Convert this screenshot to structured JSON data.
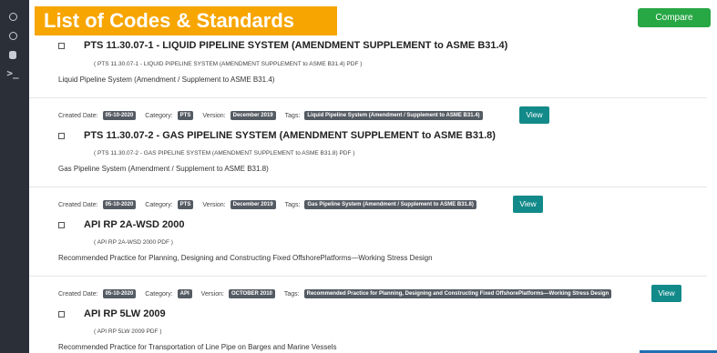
{
  "sidebar": {
    "icons": [
      "circle-icon",
      "circle-icon",
      "database-icon",
      "terminal-icon"
    ],
    "terminal_glyph": ">_"
  },
  "header": {
    "title": "List of Codes & Standards",
    "compare_label": "Compare"
  },
  "labels": {
    "created_date": "Created Date:",
    "category": "Category:",
    "version": "Version:",
    "tags": "Tags:",
    "view": "View"
  },
  "entries": [
    {
      "title": "PTS 11.30.07-1 - LIQUID PIPELINE SYSTEM (AMENDMENT SUPPLEMENT to ASME B31.4)",
      "pdf": "( PTS 11.30.07-1 - LIQUID PIPELINE SYSTEM (AMENDMENT SUPPLEMENT to ASME B31.4) PDF )",
      "description": "Liquid Pipeline System (Amendment / Supplement to ASME B31.4)",
      "created_date": "05-10-2020",
      "category": "PTS",
      "version": "December 2019",
      "tags": "Liquid Pipeline System (Amendment / Supplement to ASME B31.4)"
    },
    {
      "title": "PTS 11.30.07-2 - GAS PIPELINE SYSTEM (AMENDMENT SUPPLEMENT to ASME B31.8)",
      "pdf": "( PTS 11.30.07-2 - GAS PIPELINE SYSTEM (AMENDMENT SUPPLEMENT to ASME B31.8) PDF )",
      "description": "Gas Pipeline System (Amendment / Supplement to ASME B31.8)",
      "created_date": "05-10-2020",
      "category": "PTS",
      "version": "December 2019",
      "tags": "Gas Pipeline System (Amendment / Supplement to ASME B31.8)"
    },
    {
      "title": "API RP 2A-WSD 2000",
      "pdf": "( API RP 2A-WSD 2000 PDF )",
      "description": "Recommended Practice for Planning, Designing and Constructing Fixed OffshorePlatforms—Working Stress Design",
      "created_date": "05-10-2020",
      "category": "API",
      "version": "OCTOBER 2010",
      "tags": "Recommended Practice for Planning, Designing and Constructing Fixed OffshorePlatforms—Working Stress Design"
    },
    {
      "title": "API RP 5LW 2009",
      "pdf": "( API RP 5LW 2009 PDF )",
      "description": "Recommended Practice for Transportation of Line Pipe on Barges and Marine Vessels"
    }
  ]
}
